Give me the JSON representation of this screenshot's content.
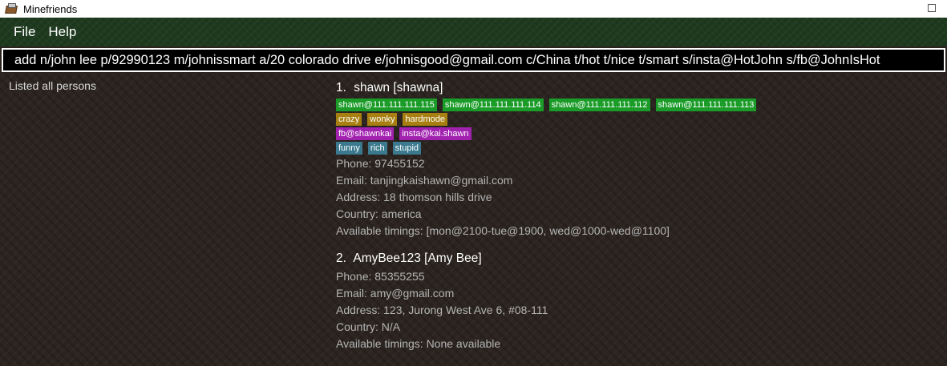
{
  "window": {
    "title": "Minefriends",
    "icon": "app-book-icon"
  },
  "menu": {
    "file_label": "File",
    "help_label": "Help"
  },
  "command": {
    "value": "add n/john lee p/92990123 m/johnissmart a/20 colorado drive e/johnisgood@gmail.com c/China t/hot t/nice t/smart s/insta@HotJohn s/fb@JohnIsHot"
  },
  "result": {
    "text": "Listed all persons"
  },
  "persons": [
    {
      "index": "1.",
      "name": "shawn",
      "alias": "[shawna]",
      "ip_tags": [
        "shawn@111.111.111.115",
        "shawn@111.111.111.114",
        "shawn@111.111.111.112",
        "shawn@111.111.111.113"
      ],
      "label_tags": [
        "crazy",
        "wonky",
        "hardmode"
      ],
      "social_tags": [
        "fb@shawnkai",
        "insta@kai.shawn"
      ],
      "trait_tags": [
        "funny",
        "rich",
        "stupid"
      ],
      "phone": "Phone: 97455152",
      "email": "Email: tanjingkaishawn@gmail.com",
      "address": "Address: 18 thomson hills drive",
      "country": "Country: america",
      "timings": "Available timings: [mon@2100-tue@1900, wed@1000-wed@1100]"
    },
    {
      "index": "2.",
      "name": "AmyBee123",
      "alias": "[Amy Bee]",
      "phone": "Phone: 85355255",
      "email": "Email: amy@gmail.com",
      "address": "Address: 123, Jurong West Ave 6, #08-111",
      "country": "Country: N/A",
      "timings": "Available timings: None available"
    }
  ],
  "colors": {
    "ip_tag": "#1b9b28",
    "label_tag": "#a88012",
    "social_tag": "#a222b0",
    "trait_tag": "#3b7a8e",
    "menubar": "#1e3a1e",
    "background": "#2b2420"
  }
}
